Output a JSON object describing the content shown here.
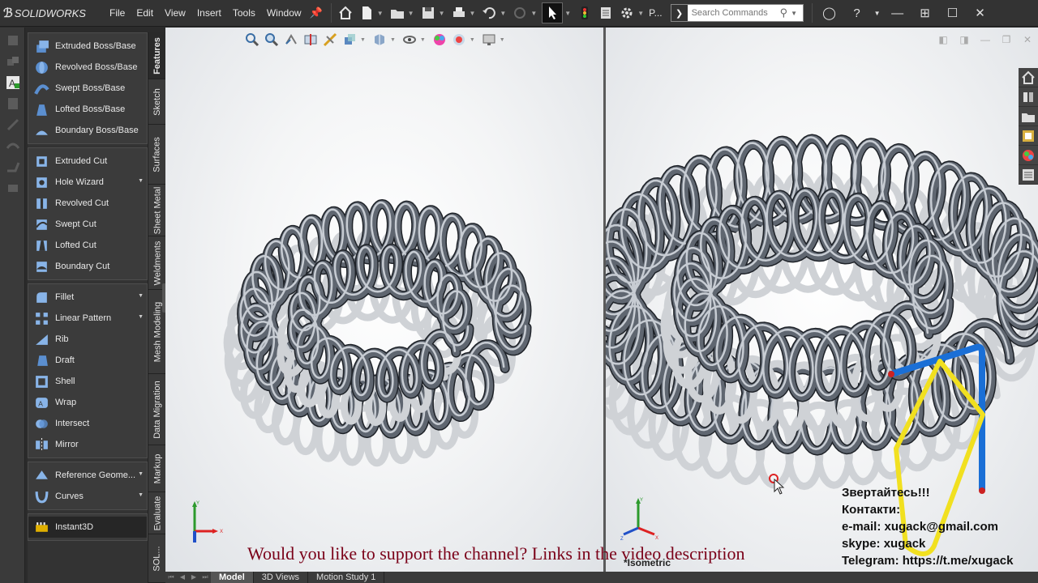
{
  "app": {
    "brand": "SOLIDWORKS",
    "menus": [
      "File",
      "Edit",
      "View",
      "Insert",
      "Tools",
      "Window"
    ],
    "partial_label": "P...",
    "search_placeholder": "Search Commands"
  },
  "features": {
    "groups": [
      [
        {
          "label": "Extruded Boss/Base",
          "icon": "extruded-boss-icon"
        },
        {
          "label": "Revolved Boss/Base",
          "icon": "revolved-boss-icon"
        },
        {
          "label": "Swept Boss/Base",
          "icon": "swept-boss-icon"
        },
        {
          "label": "Lofted Boss/Base",
          "icon": "lofted-boss-icon"
        },
        {
          "label": "Boundary Boss/Base",
          "icon": "boundary-boss-icon"
        }
      ],
      [
        {
          "label": "Extruded Cut",
          "icon": "extruded-cut-icon"
        },
        {
          "label": "Hole Wizard",
          "icon": "hole-wizard-icon"
        },
        {
          "label": "Revolved Cut",
          "icon": "revolved-cut-icon"
        },
        {
          "label": "Swept Cut",
          "icon": "swept-cut-icon"
        },
        {
          "label": "Lofted Cut",
          "icon": "lofted-cut-icon"
        },
        {
          "label": "Boundary Cut",
          "icon": "boundary-cut-icon"
        }
      ],
      [
        {
          "label": "Fillet",
          "icon": "fillet-icon"
        },
        {
          "label": "Linear Pattern",
          "icon": "linear-pattern-icon"
        },
        {
          "label": "Rib",
          "icon": "rib-icon"
        },
        {
          "label": "Draft",
          "icon": "draft-icon"
        },
        {
          "label": "Shell",
          "icon": "shell-icon"
        },
        {
          "label": "Wrap",
          "icon": "wrap-icon"
        },
        {
          "label": "Intersect",
          "icon": "intersect-icon"
        },
        {
          "label": "Mirror",
          "icon": "mirror-icon"
        }
      ],
      [
        {
          "label": "Reference Geome...",
          "icon": "reference-geometry-icon"
        },
        {
          "label": "Curves",
          "icon": "curves-icon"
        }
      ],
      [
        {
          "label": "Instant3D",
          "icon": "instant3d-icon"
        }
      ]
    ]
  },
  "vertical_tabs": [
    "Features",
    "Sketch",
    "Surfaces",
    "Sheet Metal",
    "Weldments",
    "Mesh Modeling",
    "Data Migration",
    "Markup",
    "Evaluate",
    "SOL..."
  ],
  "viewport": {
    "right_view_name": "*Isometric",
    "triad_labels": {
      "x": "X",
      "y": "Y",
      "z": "Z"
    }
  },
  "bottom_tabs": [
    "Model",
    "3D Views",
    "Motion Study 1"
  ],
  "overlay": {
    "banner": "Would you like to support the channel? Links in the video description",
    "contacts": [
      "Звертайтесь!!!",
      "Контакти:",
      "e-mail: xugack@gmail.com",
      "skype: xugack",
      "Telegram: https://t.me/xugack"
    ]
  },
  "colors": {
    "banner": "#7a0018",
    "steel": "#5f6670",
    "accent_blue": "#1a6fd6",
    "accent_yellow": "#f1e020"
  }
}
